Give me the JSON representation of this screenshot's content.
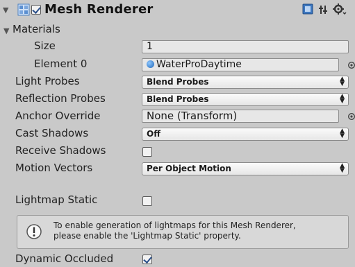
{
  "header": {
    "title": "Mesh Renderer",
    "enabled": true
  },
  "materials": {
    "label": "Materials",
    "size_label": "Size",
    "size_value": "1",
    "element_label": "Element 0",
    "element_value": "WaterProDaytime"
  },
  "properties": {
    "light_probes": {
      "label": "Light Probes",
      "value": "Blend Probes"
    },
    "reflection_probes": {
      "label": "Reflection Probes",
      "value": "Blend Probes"
    },
    "anchor_override": {
      "label": "Anchor Override",
      "value": "None (Transform)"
    },
    "cast_shadows": {
      "label": "Cast Shadows",
      "value": "Off"
    },
    "receive_shadows": {
      "label": "Receive Shadows",
      "checked": false
    },
    "motion_vectors": {
      "label": "Motion Vectors",
      "value": "Per Object Motion"
    },
    "lightmap_static": {
      "label": "Lightmap Static",
      "checked": false
    }
  },
  "info": {
    "line1": "To enable generation of lightmaps for this Mesh Renderer,",
    "line2": "please enable the 'Lightmap Static' property."
  },
  "dynamic_occluded": {
    "label": "Dynamic Occluded",
    "checked": true
  },
  "icons": {
    "component": "mesh-renderer-icon",
    "help": "help-book-icon",
    "presets": "presets-icon",
    "settings": "gear-icon",
    "picker": "object-picker-icon",
    "info": "info-icon"
  }
}
